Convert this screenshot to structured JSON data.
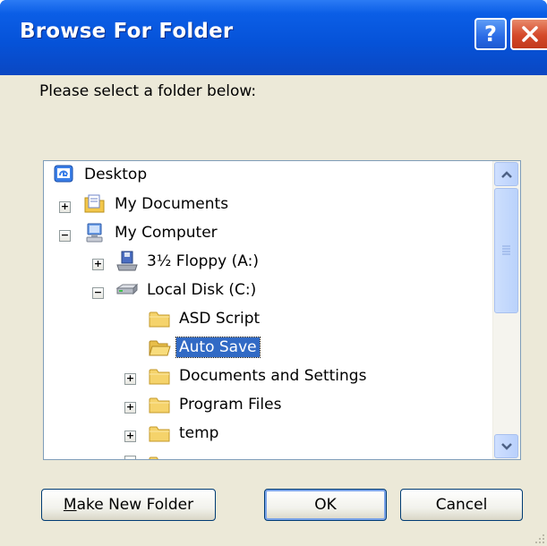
{
  "dialog": {
    "title": "Browse For Folder",
    "help_label": "?",
    "prompt": "Please select a folder below:"
  },
  "tree": {
    "items": [
      {
        "label": "Desktop",
        "icon": "desktop-icon",
        "expander": ""
      },
      {
        "label": "My Documents",
        "icon": "my-documents-icon",
        "expander": "+"
      },
      {
        "label": "My Computer",
        "icon": "my-computer-icon",
        "expander": "−"
      },
      {
        "label": "3½ Floppy (A:)",
        "icon": "floppy-drive-icon",
        "expander": "+"
      },
      {
        "label": "Local Disk (C:)",
        "icon": "hard-disk-icon",
        "expander": "−"
      },
      {
        "label": "ASD Script",
        "icon": "folder-icon",
        "expander": ""
      },
      {
        "label": "Auto Save",
        "icon": "open-folder-icon",
        "expander": "",
        "selected": true
      },
      {
        "label": "Documents and Settings",
        "icon": "folder-icon",
        "expander": "+"
      },
      {
        "label": "Program Files",
        "icon": "folder-icon",
        "expander": "+"
      },
      {
        "label": "temp",
        "icon": "folder-icon",
        "expander": "+"
      }
    ]
  },
  "buttons": {
    "make_new_folder_mnemonic": "M",
    "make_new_folder_rest": "ake New Folder",
    "ok": "OK",
    "cancel": "Cancel"
  },
  "colors": {
    "titlebar": "#0653d9",
    "selection": "#316ac5",
    "dialog_face": "#ece9d8",
    "close_button": "#d5492a"
  }
}
